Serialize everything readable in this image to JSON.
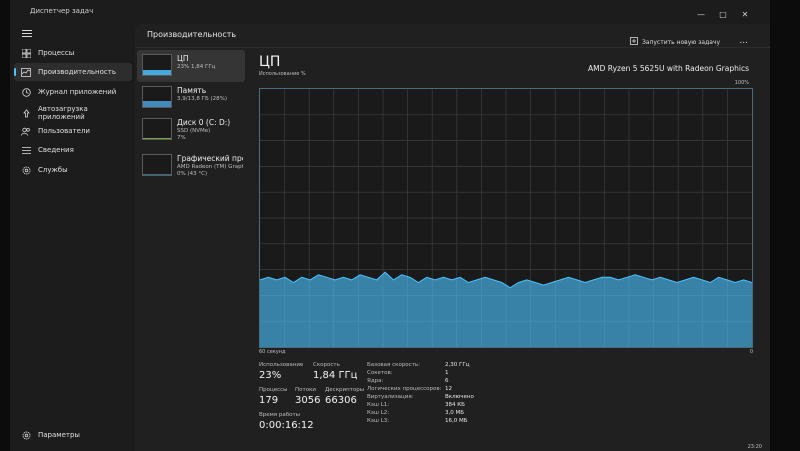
{
  "window": {
    "title": "Диспетчер задач"
  },
  "sidebar": {
    "items": [
      {
        "id": "processes",
        "label": "Процессы",
        "icon": "grid-icon"
      },
      {
        "id": "performance",
        "label": "Производительность",
        "icon": "performance-chart-icon",
        "active": true
      },
      {
        "id": "app-history",
        "label": "Журнал приложений",
        "icon": "history-icon"
      },
      {
        "id": "startup",
        "label": "Автозагрузка приложений",
        "icon": "startup-icon"
      },
      {
        "id": "users",
        "label": "Пользователи",
        "icon": "users-icon"
      },
      {
        "id": "details",
        "label": "Сведения",
        "icon": "list-icon"
      },
      {
        "id": "services",
        "label": "Службы",
        "icon": "services-gear-icon"
      }
    ],
    "settings_label": "Параметры"
  },
  "header": {
    "title": "Производительность",
    "run_task_label": "Запустить новую задачу",
    "more_label": "..."
  },
  "perf_list": [
    {
      "name": "ЦП",
      "sub1": "23% 1,84 ГГц",
      "sub2": "",
      "color": "#4cc2ff",
      "usage": 0.23,
      "active": true
    },
    {
      "name": "Память",
      "sub1": "3,9/13,8 ГБ (28%)",
      "sub2": "",
      "color": "#4a9fd8",
      "usage": 0.28
    },
    {
      "name": "Диск 0 (C: D:)",
      "sub1": "SSD (NVMe)",
      "sub2": "7%",
      "color": "#8bc34a",
      "usage": 0.07
    },
    {
      "name": "Графический процессор",
      "sub1": "AMD Radeon (TM) Graphics",
      "sub2": "0% (43 °C)",
      "color": "#4cc2ff",
      "usage": 0.0
    }
  ],
  "main": {
    "heading": "ЦП",
    "cpu_model": "AMD Ryzen 5 5625U with Radeon Graphics",
    "util_label": "Использование %",
    "max_label": "100%",
    "time_label": "60 секунд",
    "zero_label": "0"
  },
  "stats": {
    "usage_label": "Использование",
    "usage_value": "23%",
    "speed_label": "Скорость",
    "speed_value": "1,84 ГГц",
    "processes_label": "Процессы",
    "processes_value": "179",
    "threads_label": "Потоки",
    "threads_value": "3056",
    "handles_label": "Дескрипторы",
    "handles_value": "66306",
    "uptime_label": "Время работы",
    "uptime_value": "0:00:16:12"
  },
  "specs": [
    {
      "label": "Базовая скорость:",
      "value": "2,30 ГГц"
    },
    {
      "label": "Сокетов:",
      "value": "1"
    },
    {
      "label": "Ядра:",
      "value": "6"
    },
    {
      "label": "Логических процессоров:",
      "value": "12"
    },
    {
      "label": "Виртуализация:",
      "value": "Включено"
    },
    {
      "label": "Кэш L1:",
      "value": "384 КБ"
    },
    {
      "label": "Кэш L2:",
      "value": "3,0 МБ"
    },
    {
      "label": "Кэш L3:",
      "value": "16,0 МБ"
    }
  ],
  "chart_data": {
    "type": "area",
    "ylim": [
      0,
      100
    ],
    "color": "#4cc2ff",
    "values": [
      26,
      27,
      26,
      27,
      25,
      27,
      26,
      28,
      27,
      26,
      27,
      26,
      28,
      27,
      26,
      29,
      26,
      28,
      27,
      25,
      27,
      26,
      27,
      26,
      27,
      25,
      26,
      27,
      26,
      25,
      23,
      25,
      26,
      25,
      24,
      25,
      26,
      27,
      26,
      25,
      26,
      27,
      27,
      26,
      27,
      28,
      27,
      26,
      27,
      26,
      25,
      26,
      27,
      26,
      25,
      27,
      26,
      25,
      26,
      25
    ]
  },
  "clock": "23:20"
}
